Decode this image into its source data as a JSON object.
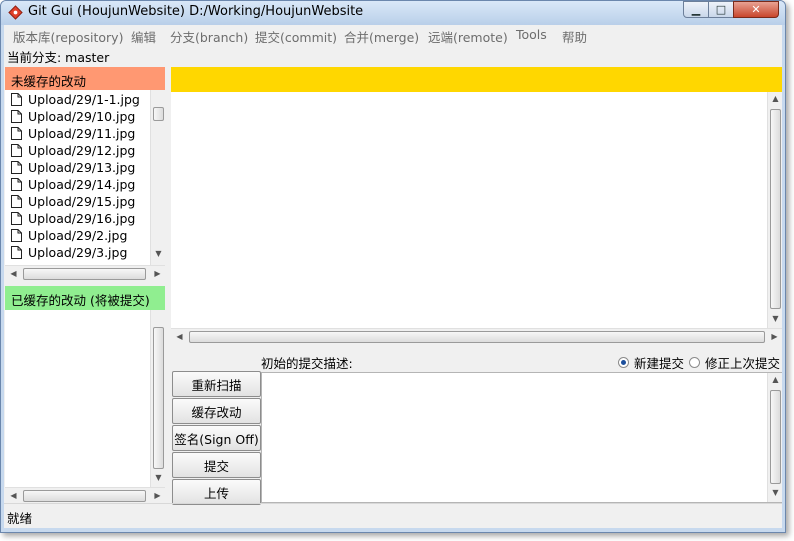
{
  "window": {
    "title": "Git Gui (HoujunWebsite) D:/Working/HoujunWebsite"
  },
  "menu": {
    "items": [
      "版本库(repository)",
      "编辑",
      "分支(branch)",
      "提交(commit)",
      "合并(merge)",
      "远端(remote)",
      "Tools",
      "帮助"
    ]
  },
  "branch": {
    "label": "当前分支: master"
  },
  "unstaged": {
    "header": "未缓存的改动",
    "files": [
      "Upload/29/1-1.jpg",
      "Upload/29/10.jpg",
      "Upload/29/11.jpg",
      "Upload/29/12.jpg",
      "Upload/29/13.jpg",
      "Upload/29/14.jpg",
      "Upload/29/15.jpg",
      "Upload/29/16.jpg",
      "Upload/29/2.jpg",
      "Upload/29/3.jpg"
    ]
  },
  "staged": {
    "header": "已缓存的改动 (将被提交)",
    "files": []
  },
  "commit": {
    "description_label": "初始的提交描述:",
    "radio_new": "新建提交",
    "radio_amend": "修正上次提交",
    "selected": "new",
    "message": ""
  },
  "buttons": {
    "rescan": "重新扫描",
    "stage": "缓存改动",
    "signoff": "签名(Sign Off)",
    "commit": "提交",
    "push": "上传"
  },
  "status": {
    "text": "就绪"
  },
  "colors": {
    "unstaged_header": "#ff9872",
    "staged_header": "#90ee90",
    "diff_header": "#ffd700"
  },
  "icons": {
    "app": "git-diamond-icon",
    "file": "file-icon"
  }
}
